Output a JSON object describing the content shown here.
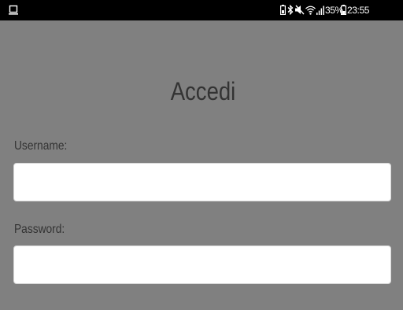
{
  "status_bar": {
    "battery_percent": "35%",
    "time": "23:55",
    "icons": [
      "screen-icon",
      "battery-saver-icon",
      "bluetooth-icon",
      "mute-icon",
      "wifi-icon",
      "signal-icon",
      "battery-icon"
    ]
  },
  "form": {
    "title": "Accedi",
    "username_label": "Username:",
    "username_value": "",
    "password_label": "Password:",
    "password_value": ""
  },
  "colors": {
    "background": "#808080",
    "status_bar": "#000000",
    "text": "#333333",
    "input_bg": "#ffffff"
  }
}
